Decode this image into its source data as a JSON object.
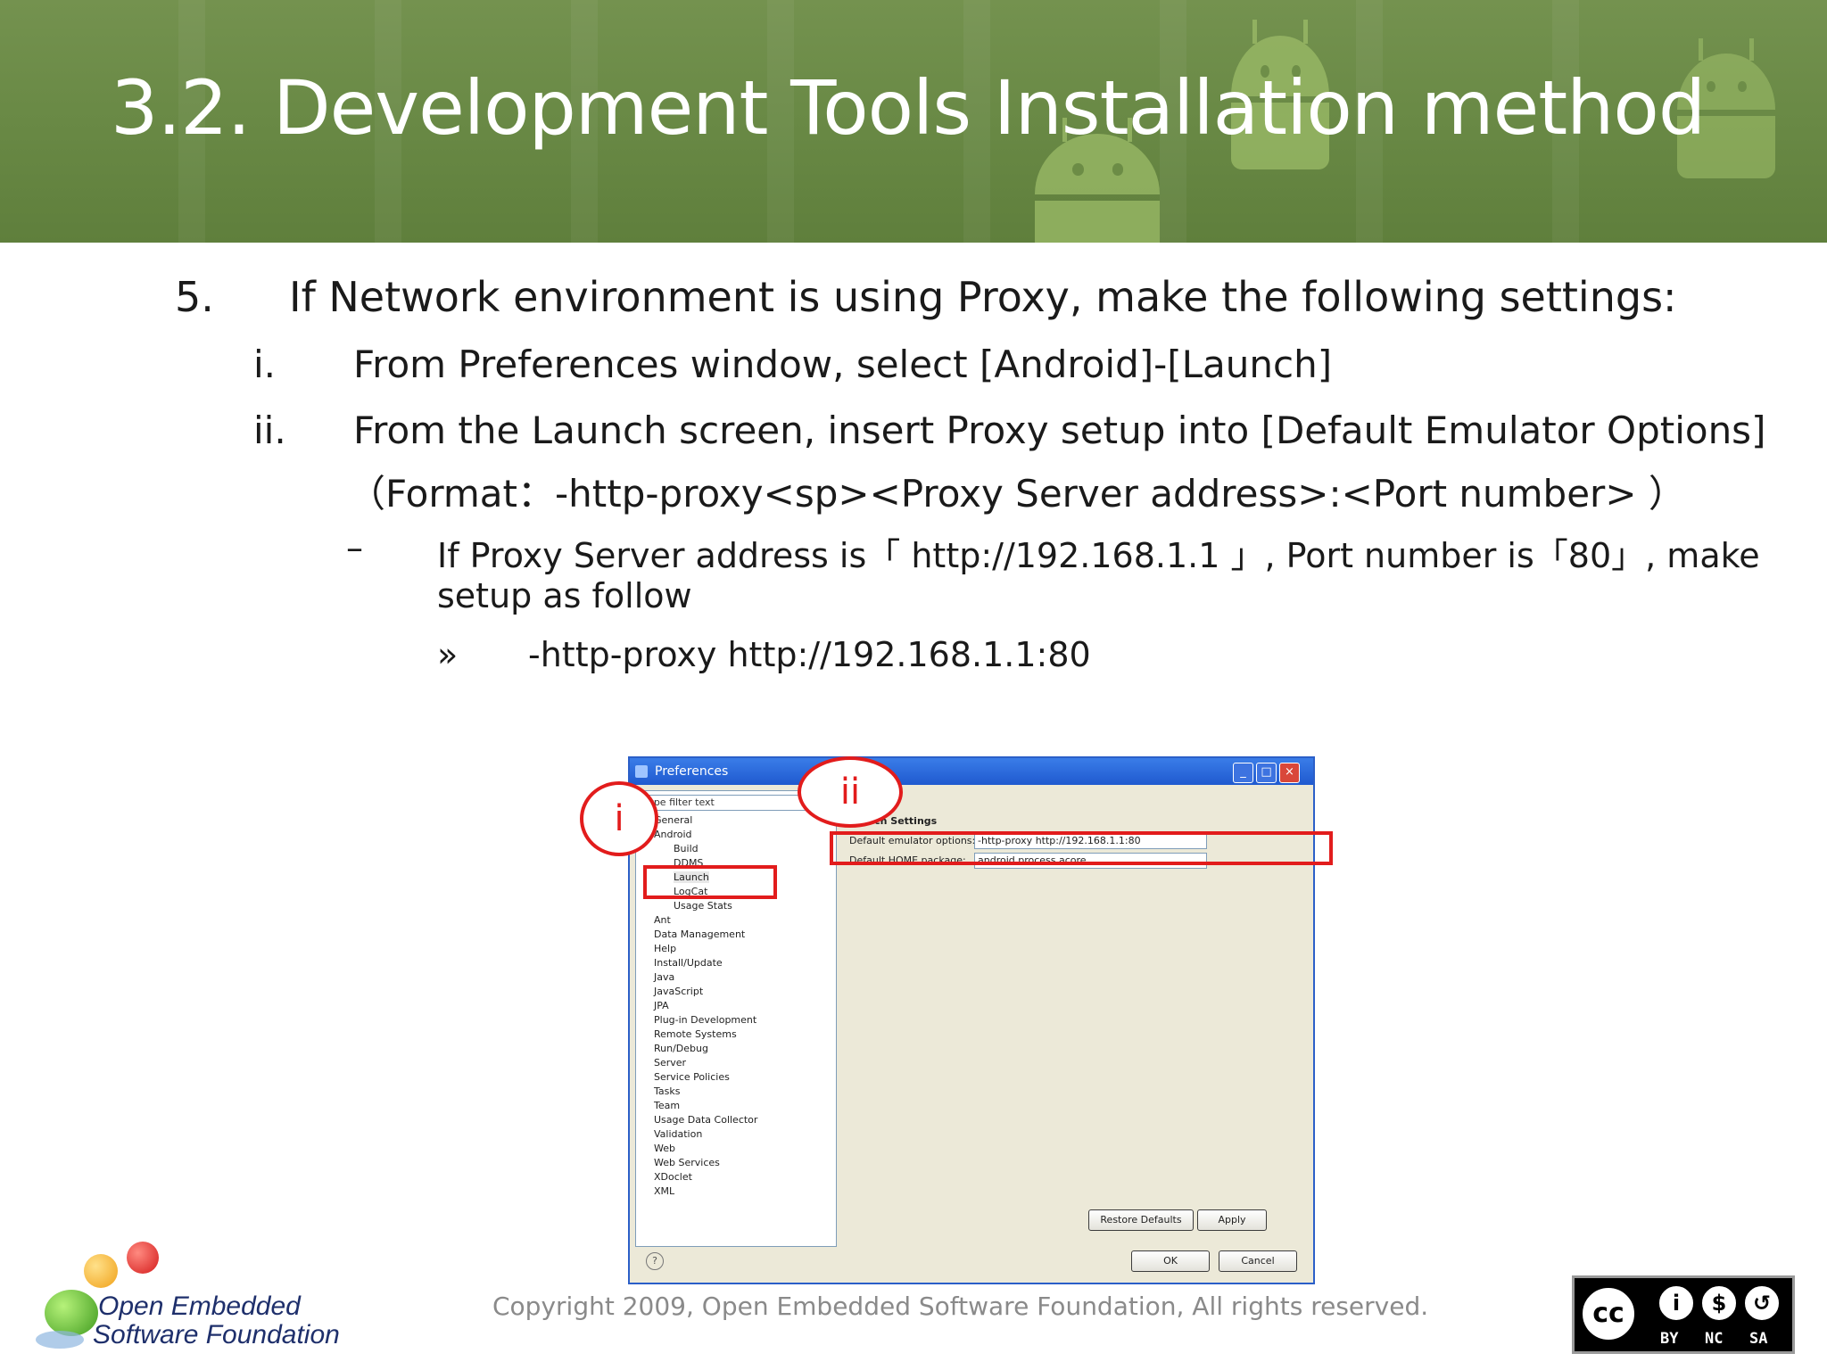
{
  "slide": {
    "title": "3.2. Development Tools Installation method",
    "step_number": "5.",
    "step_text": "If Network environment is using Proxy, make the following settings:",
    "sub_i_marker": "i.",
    "sub_i_text": "From Preferences window, select [Android]-[Launch]",
    "sub_ii_marker": "ii.",
    "sub_ii_text": "From the Launch screen, insert Proxy setup into [Default Emulator Options]",
    "sub_ii_format": "（Format：-http-proxy<sp><Proxy Server address>:<Port number> ）",
    "dash_marker": "–",
    "dash_text_1": "If Proxy Server address is「 http://192.168.1.1 」, Port number is「80」, make",
    "dash_text_2": "setup as follow",
    "raquo_marker": "»",
    "raquo_text": "-http-proxy http://192.168.1.1:80"
  },
  "screenshot": {
    "window_title": "Preferences",
    "filter_text": "type filter text",
    "tree_items": [
      "General",
      "Android",
      "Build",
      "DDMS",
      "Launch",
      "LogCat",
      "Usage Stats",
      "Ant",
      "Data Management",
      "Help",
      "Install/Update",
      "Java",
      "JavaScript",
      "JPA",
      "Plug-in Development",
      "Remote Systems",
      "Run/Debug",
      "Server",
      "Service Policies",
      "Tasks",
      "Team",
      "Usage Data Collector",
      "Validation",
      "Web",
      "Web Services",
      "XDoclet",
      "XML"
    ],
    "section_title": "Launch Settings",
    "emulator_label": "Default emulator options:",
    "emulator_value": "-http-proxy http://192.168.1.1:80",
    "home_label": "Default HOME package:",
    "home_value": "android.process.acore",
    "restore_label": "Restore Defaults",
    "apply_label": "Apply",
    "ok_label": "OK",
    "cancel_label": "Cancel",
    "help_glyph": "?"
  },
  "annotations": {
    "marker_i": "i",
    "marker_ii": "ii",
    "color": "#e21c1c"
  },
  "footer": {
    "logo_line1": "Open Embedded",
    "logo_line2": "Software Foundation",
    "copyright": "Copyright 2009, Open Embedded Software Foundation, All rights reserved.",
    "cc_by": "BY",
    "cc_nc": "NC",
    "cc_sa": "SA",
    "cc_logo": "cc"
  },
  "colors": {
    "header_green": "#6a8a46",
    "accent_red": "#e21c1c",
    "window_blue": "#2b5fc8"
  }
}
